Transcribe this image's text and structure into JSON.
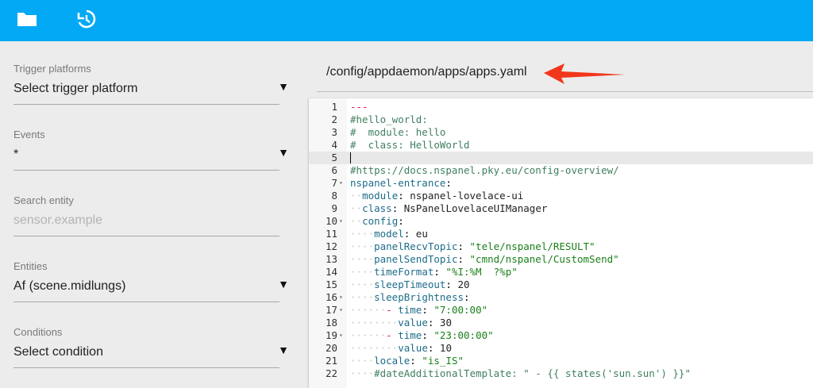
{
  "toolbar": {
    "folder_icon": "folder-icon",
    "history_icon": "history-icon"
  },
  "sidebar": {
    "fields": [
      {
        "label": "Trigger platforms",
        "value": "Select trigger platform",
        "placeholder": false
      },
      {
        "label": "Events",
        "value": "*",
        "placeholder": false
      },
      {
        "label": "Search entity",
        "value": "sensor.example",
        "placeholder": true
      },
      {
        "label": "Entities",
        "value": "Af (scene.midlungs)",
        "placeholder": false
      },
      {
        "label": "Conditions",
        "value": "Select condition",
        "placeholder": false
      }
    ]
  },
  "file": {
    "path": "/config/appdaemon/apps/apps.yaml"
  },
  "colors": {
    "header": "#03a9f4",
    "arrow": "#f2361b"
  },
  "editor": {
    "active_line": 5,
    "lines": [
      "---",
      "#hello_world:",
      "#  module: hello",
      "#  class: HelloWorld",
      "",
      "#https://docs.nspanel.pky.eu/config-overview/",
      "nspanel-entrance:",
      "  module: nspanel-lovelace-ui",
      "  class: NsPanelLovelaceUIManager",
      "  config:",
      "    model: eu",
      "    panelRecvTopic: \"tele/nspanel/RESULT\"",
      "    panelSendTopic: \"cmnd/nspanel/CustomSend\"",
      "    timeFormat: \"%I:%M  ?%p\"",
      "    sleepTimeout: 20",
      "    sleepBrightness:",
      "      - time: \"7:00:00\"",
      "        value: 30",
      "      - time: \"23:00:00\"",
      "        value: 10",
      "    locale: \"is_IS\"",
      "    #dateAdditionalTemplate: \" - {{ states('sun.sun') }}\""
    ],
    "fold_lines": [
      7,
      10,
      16,
      17,
      19
    ]
  }
}
